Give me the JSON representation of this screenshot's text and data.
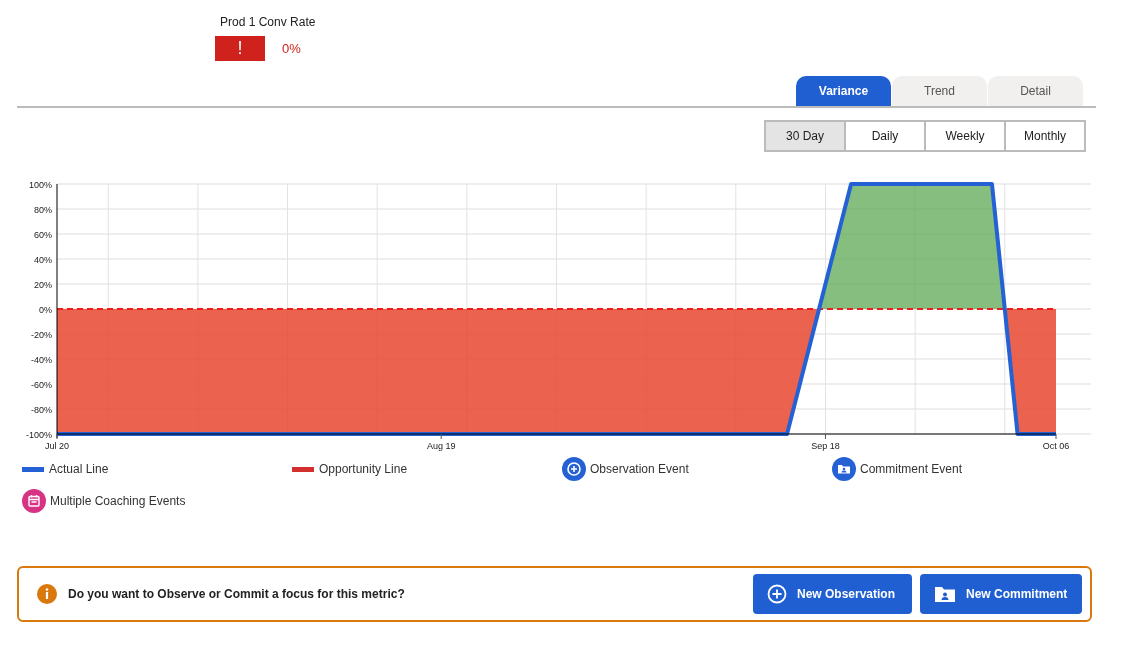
{
  "metric": {
    "title": "Prod 1 Conv Rate",
    "badge": "!",
    "value": "0%"
  },
  "tabs": [
    {
      "label": "Variance",
      "selected": true
    },
    {
      "label": "Trend",
      "selected": false
    },
    {
      "label": "Detail",
      "selected": false
    }
  ],
  "periods": [
    {
      "label": "30 Day",
      "selected": true
    },
    {
      "label": "Daily",
      "selected": false
    },
    {
      "label": "Weekly",
      "selected": false
    },
    {
      "label": "Monthly",
      "selected": false
    }
  ],
  "chart": {
    "chart_data": {
      "type": "line",
      "ylim": [
        -100,
        100
      ],
      "grid": true,
      "categories": [
        "Jul 20",
        null,
        null,
        null,
        null,
        null,
        null,
        null,
        null,
        null,
        null,
        null,
        null,
        null,
        null,
        null,
        null,
        null,
        null,
        null,
        null,
        null,
        null,
        null,
        null,
        null,
        null,
        null,
        null,
        null,
        "Aug 19",
        null,
        null,
        null,
        null,
        null,
        null,
        null,
        null,
        null,
        null,
        null,
        null,
        null,
        null,
        null,
        null,
        null,
        null,
        null,
        null,
        null,
        null,
        null,
        null,
        null,
        null,
        null,
        null,
        null,
        "Sep 18",
        null,
        null,
        null,
        null,
        null,
        null,
        null,
        null,
        null,
        null,
        null,
        null,
        null,
        null,
        null,
        null,
        null,
        "Oct 06"
      ],
      "series": [
        {
          "name": "Actual Line",
          "color": "#2461d4",
          "line_style": "solid",
          "values": [
            -100,
            -100,
            -100,
            -100,
            -100,
            -100,
            -100,
            -100,
            -100,
            -100,
            -100,
            -100,
            -100,
            -100,
            -100,
            -100,
            -100,
            -100,
            -100,
            -100,
            -100,
            -100,
            -100,
            -100,
            -100,
            -100,
            -100,
            -100,
            -100,
            -100,
            -100,
            -100,
            -100,
            -100,
            -100,
            -100,
            -100,
            -100,
            -100,
            -100,
            -100,
            -100,
            -100,
            -100,
            -100,
            -100,
            -100,
            -100,
            -100,
            -100,
            -100,
            -100,
            -100,
            -100,
            -100,
            -100,
            -100,
            -100,
            -60,
            -20,
            20,
            60,
            100,
            100,
            100,
            100,
            100,
            100,
            100,
            100,
            100,
            100,
            100,
            100,
            0,
            -100,
            -100,
            -100,
            -100
          ]
        },
        {
          "name": "Opportunity Line",
          "color": "#ee1c1c",
          "line_style": "dashed",
          "values": [
            0,
            0,
            0,
            0,
            0,
            0,
            0,
            0,
            0,
            0,
            0,
            0,
            0,
            0,
            0,
            0,
            0,
            0,
            0,
            0,
            0,
            0,
            0,
            0,
            0,
            0,
            0,
            0,
            0,
            0,
            0,
            0,
            0,
            0,
            0,
            0,
            0,
            0,
            0,
            0,
            0,
            0,
            0,
            0,
            0,
            0,
            0,
            0,
            0,
            0,
            0,
            0,
            0,
            0,
            0,
            0,
            0,
            0,
            0,
            0,
            0,
            0,
            0,
            0,
            0,
            0,
            0,
            0,
            0,
            0,
            0,
            0,
            0,
            0,
            0,
            0,
            0,
            0,
            0
          ]
        }
      ],
      "yticks": [
        {
          "value": 100,
          "label": "100%"
        },
        {
          "value": 80,
          "label": "80%"
        },
        {
          "value": 60,
          "label": "60%"
        },
        {
          "value": 40,
          "label": "40%"
        },
        {
          "value": 20,
          "label": "20%"
        },
        {
          "value": 0,
          "label": "0%"
        },
        {
          "value": -20,
          "label": "-20%"
        },
        {
          "value": -40,
          "label": "-40%"
        },
        {
          "value": -60,
          "label": "-60%"
        },
        {
          "value": -80,
          "label": "-80%"
        },
        {
          "value": -100,
          "label": "-100%"
        }
      ]
    }
  },
  "legend": [
    {
      "kind": "line",
      "color": "#2461d4"
    },
    {
      "kind": "line",
      "color": "#d32f2f"
    },
    {
      "label": "Observation Event",
      "kind": "observation",
      "color": "#2461d4"
    },
    {
      "label": "Commitment Event",
      "kind": "commitment",
      "color": "#2461d4"
    },
    {
      "label": "Multiple Coaching Events",
      "kind": "coaching",
      "color": "#d63384"
    }
  ],
  "prompt": {
    "text": "Do you want to Observe or Commit a focus for this metric?",
    "buttons": [
      {
        "label": "New Observation",
        "kind": "observation"
      },
      {
        "label": "New Commitment",
        "kind": "commitment"
      }
    ]
  }
}
